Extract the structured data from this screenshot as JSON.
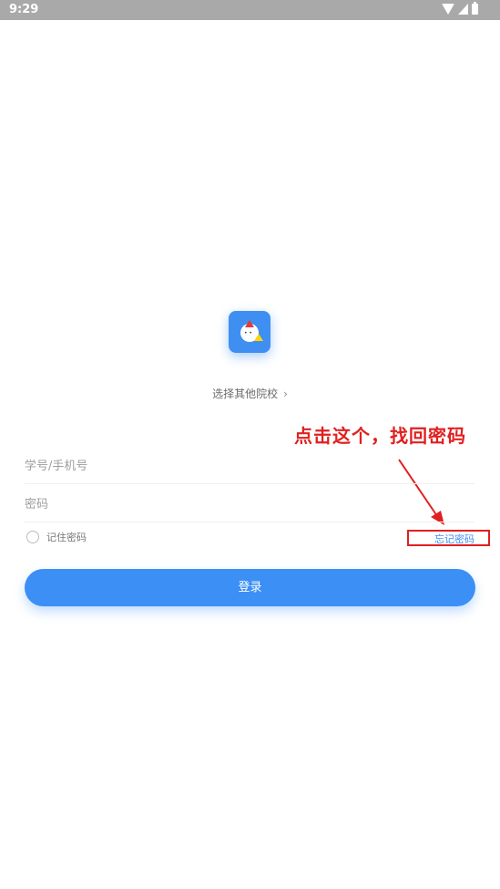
{
  "status_bar": {
    "time": "9:29"
  },
  "school": {
    "label": "选择其他院校",
    "chevron": "chevron-right-icon"
  },
  "annotation": {
    "text": "点击这个，找回密码",
    "color": "#e02020"
  },
  "form": {
    "account_placeholder": "学号/手机号",
    "password_placeholder": "密码",
    "remember_label": "记住密码",
    "forgot_label": "忘记密码",
    "login_label": "登录"
  },
  "colors": {
    "primary": "#3b8ff5",
    "annotation": "#e02020"
  }
}
